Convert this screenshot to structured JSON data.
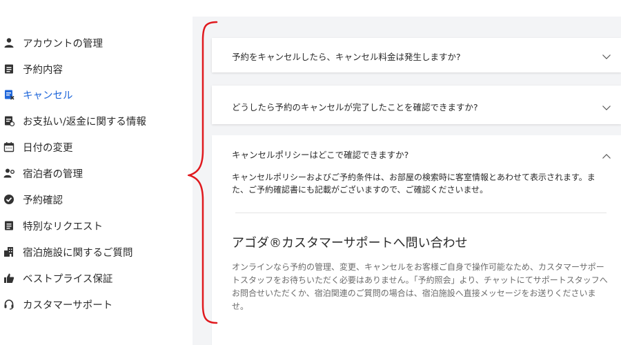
{
  "sidebar": {
    "items": [
      {
        "label": "アカウントの管理",
        "icon": "person-icon"
      },
      {
        "label": "予約内容",
        "icon": "document-icon"
      },
      {
        "label": "キャンセル",
        "icon": "cancel-document-icon",
        "active": true
      },
      {
        "label": "お支払い/返金に関する情報",
        "icon": "payment-document-icon"
      },
      {
        "label": "日付の変更",
        "icon": "calendar-icon"
      },
      {
        "label": "宿泊者の管理",
        "icon": "guest-settings-icon"
      },
      {
        "label": "予約確認",
        "icon": "check-circle-icon"
      },
      {
        "label": "特別なリクエスト",
        "icon": "document-icon"
      },
      {
        "label": "宿泊施設に関するご質問",
        "icon": "building-icon"
      },
      {
        "label": "ベストプライス保証",
        "icon": "thumbs-up-icon"
      },
      {
        "label": "カスタマーサポート",
        "icon": "headset-icon"
      }
    ]
  },
  "faq": {
    "items": [
      {
        "question": "予約をキャンセルしたら、キャンセル料金は発生しますか?",
        "expanded": false
      },
      {
        "question": "どうしたら予約のキャンセルが完了したことを確認できますか?",
        "expanded": false
      },
      {
        "question": "キャンセルポリシーはどこで確認できますか?",
        "expanded": true,
        "answer_line1": "キャンセルポリシーおよびご予約条件は、お部屋の検索時に客室情報とあわせて表示されます。ま",
        "answer_line2": "た、ご予約確認書にも記載がございますので、ご確認くださいませ。"
      }
    ]
  },
  "contact": {
    "title": "アゴダ®カスタマーサポートへ問い合わせ",
    "line1": "オンラインなら予約の管理、変更、キャンセルをお客様ご自身で操作可能なため、カスタマーサポー",
    "line2": "トスタッフをお待ちいただく必要はありません。「予約照会」より、チャットにてサポートスタッフへ",
    "line3": "お問合せいただくか、宿泊関連のご質問の場合は、宿泊施設へ直接メッセージをお送りくださいま",
    "line4": "せ。"
  },
  "colors": {
    "accent": "#2067da",
    "annotation": "#e0191e"
  }
}
